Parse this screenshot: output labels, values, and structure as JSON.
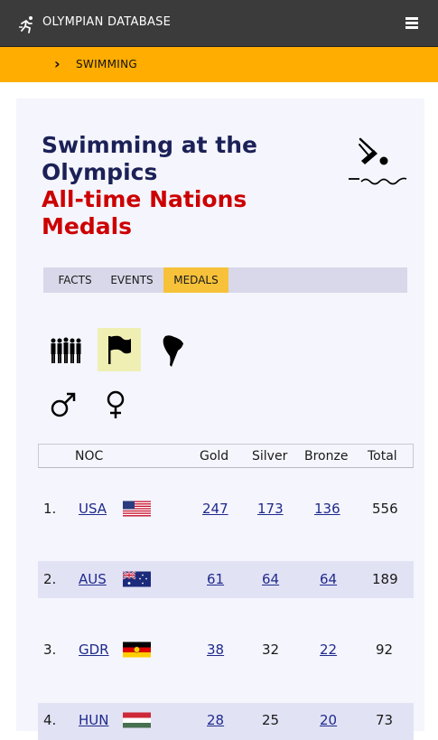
{
  "header": {
    "site_title": "OLYMPIAN DATABASE"
  },
  "breadcrumb": {
    "label": "SWIMMING"
  },
  "page": {
    "title_line1": "Swimming at the",
    "title_line2": "Olympics",
    "subtitle_line1": "All-time Nations",
    "subtitle_line2": "Medals"
  },
  "tabs": [
    {
      "label": "FACTS",
      "active": false
    },
    {
      "label": "EVENTS",
      "active": false
    },
    {
      "label": "MEDALS",
      "active": true
    }
  ],
  "table": {
    "headers": {
      "noc": "NOC",
      "gold": "Gold",
      "silver": "Silver",
      "bronze": "Bronze",
      "total": "Total"
    },
    "rows": [
      {
        "rank": "1.",
        "noc": "USA",
        "gold": "247",
        "silver": "173",
        "bronze": "136",
        "total": "556",
        "silver_link": true
      },
      {
        "rank": "2.",
        "noc": "AUS",
        "gold": "61",
        "silver": "64",
        "bronze": "64",
        "total": "189",
        "silver_link": true
      },
      {
        "rank": "3.",
        "noc": "GDR",
        "gold": "38",
        "silver": "32",
        "bronze": "22",
        "total": "92",
        "silver_link": false
      },
      {
        "rank": "4.",
        "noc": "HUN",
        "gold": "28",
        "silver": "25",
        "bronze": "20",
        "total": "73",
        "silver_link": false
      }
    ]
  },
  "colors": {
    "header_bg": "#3b3b3b",
    "breadcrumb_bg": "#ffad00",
    "title_navy": "#1b2157",
    "subtitle_red": "#cc0000",
    "active_tab": "#f7c23a",
    "link": "#1f2a8c"
  }
}
